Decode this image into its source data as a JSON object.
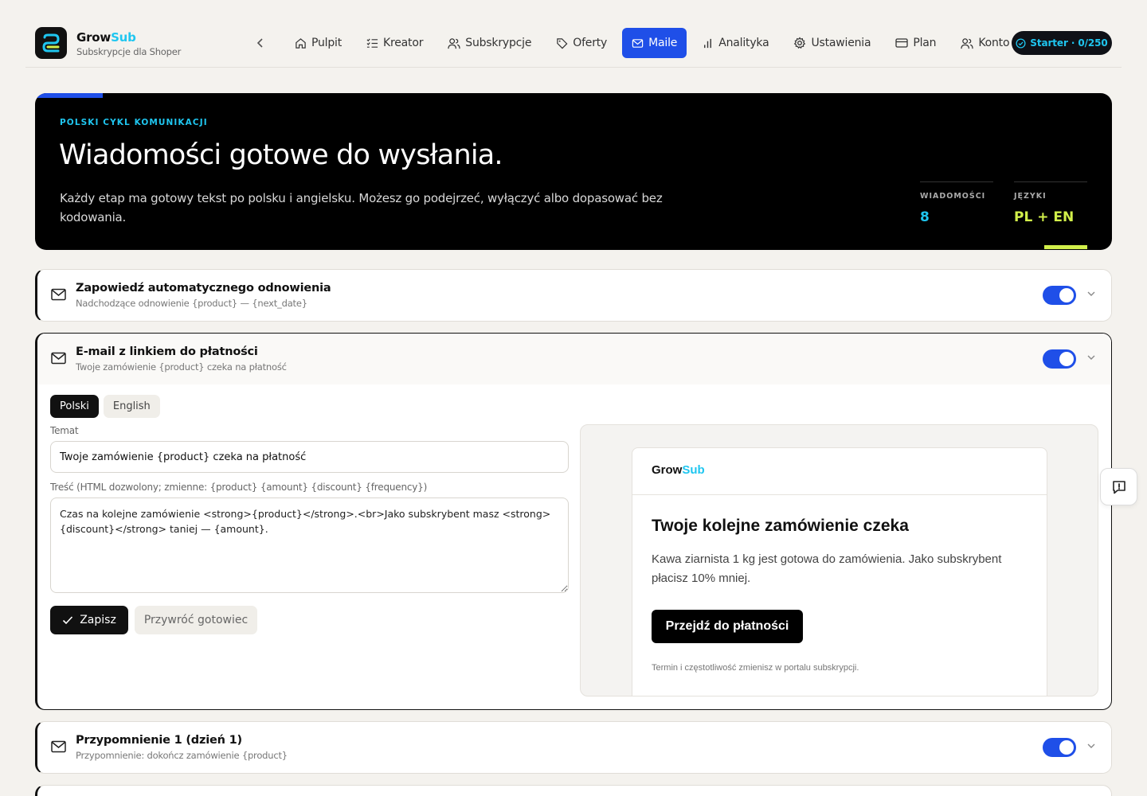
{
  "app": {
    "brand_part1": "Grow",
    "brand_part2": "Sub",
    "subtitle": "Subskrypcje dla Shoper"
  },
  "nav": {
    "back_icon": "chevron-left-icon",
    "items": [
      {
        "label": "Pulpit",
        "icon": "home-icon"
      },
      {
        "label": "Kreator",
        "icon": "list-icon"
      },
      {
        "label": "Subskrypcje",
        "icon": "users-icon"
      },
      {
        "label": "Oferty",
        "icon": "tag-icon"
      },
      {
        "label": "Maile",
        "icon": "mail-icon",
        "active": true
      },
      {
        "label": "Analityka",
        "icon": "bar-chart-icon"
      },
      {
        "label": "Ustawienia",
        "icon": "gear-icon"
      },
      {
        "label": "Plan",
        "icon": "card-icon"
      },
      {
        "label": "Konto",
        "icon": "user-icon"
      }
    ],
    "plan_pill": "Starter · 0/250"
  },
  "hero": {
    "eyebrow": "POLSKI CYKL KOMUNIKACJI",
    "title": "Wiadomości gotowe do wysłania.",
    "text": "Każdy etap ma gotowy tekst po polsku i angielsku. Możesz go podejrzeć, wyłączyć albo dopasować bez kodowania.",
    "stats": [
      {
        "label": "WIADOMOŚCI",
        "value": "8"
      },
      {
        "label": "JĘZYKI",
        "value": "PL + EN"
      }
    ]
  },
  "cards": [
    {
      "title": "Zapowiedź automatycznego odnowienia",
      "subtitle": "Nadchodzące odnowienie {product} — {next_date}",
      "enabled": true
    },
    {
      "title": "E-mail z linkiem do płatności",
      "subtitle": "Twoje zamówienie {product} czeka na płatność",
      "enabled": true
    },
    {
      "title": "Przypomnienie 1 (dzień 1)",
      "subtitle": "Przypomnienie: dokończ zamówienie {product}",
      "enabled": true
    }
  ],
  "editor": {
    "tabs": [
      "Polski",
      "English"
    ],
    "subject_label": "Temat",
    "subject_value": "Twoje zamówienie {product} czeka na płatność",
    "body_label": "Treść (HTML dozwolony; zmienne: {product} {amount} {discount} {frequency})",
    "body_value": "Czas na kolejne zamówienie <strong>{product}</strong>.<br>Jako subskrybent masz <strong>{discount}</strong> taniej — {amount}.",
    "save_label": "Zapisz",
    "reset_label": "Przywróć gotowiec"
  },
  "preview": {
    "brand_part1": "Grow",
    "brand_part2": "Sub",
    "title": "Twoje kolejne zamówienie czeka",
    "text": "Kawa ziarnista 1 kg jest gotowa do zamówienia. Jako subskrybent płacisz 10% mniej.",
    "cta": "Przejdź do płatności",
    "footer": "Termin i częstotliwość zmienisz w portalu subskrypcji."
  },
  "colors": {
    "accent_blue": "#1f4fe8",
    "accent_cyan": "#1fc6f0",
    "accent_lime": "#d2f04a",
    "background": "#f4f2ee"
  }
}
